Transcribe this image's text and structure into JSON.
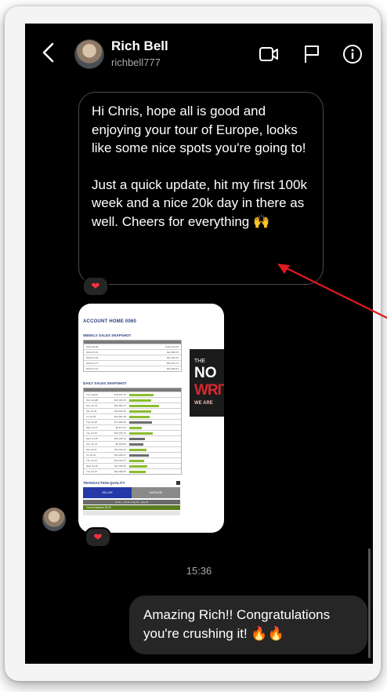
{
  "header": {
    "name": "Rich Bell",
    "handle": "richbell777"
  },
  "messages": {
    "incoming_paragraph_1": "Hi Chris, hope all is good and enjoying your tour of Europe, looks like some nice spots you're going to!",
    "incoming_paragraph_2": "Just a quick update, hit my first 100k week and a nice 20k day in there as well. Cheers for everything 🙌",
    "reaction": "❤",
    "timestamp": "15:36",
    "outgoing": "Amazing Rich!! Congratulations you're crushing it! 🔥🔥"
  },
  "attachment": {
    "title": "ACCOUNT HOME 0060",
    "weekly_heading": "WEEKLY SALES SNAPSHOT",
    "daily_heading": "DAILY SALES SNAPSHOT",
    "quality_heading": "TRANSACTION QUALITY",
    "seller_label": "SELLER",
    "average_label": "AVERAGE",
    "date_range": "Jul 31 - Jul 31 | Aug 01 - Aug 01",
    "current_balance": "Current Balance   $0.00",
    "weekly_rows": [
      {
        "date": "2022-08-08",
        "value": "$116,614.00"
      },
      {
        "date": "2022-07-31",
        "value": "$34,838.78"
      },
      {
        "date": "2022-07-24",
        "value": "$62,400.32"
      },
      {
        "date": "2022-07-17",
        "value": "$69,570.74"
      },
      {
        "date": "2022-07-10",
        "value": "$43,003.42"
      }
    ],
    "daily_rows": [
      {
        "day": "Tue Aug09",
        "value": "$19,872.78",
        "level": 0.62,
        "color": "g"
      },
      {
        "day": "Mon Aug08",
        "value": "$15,432.56",
        "level": 0.55,
        "color": "g"
      },
      {
        "day": "Sun Jul 31",
        "value": "$26,893.37",
        "level": 0.75,
        "color": "g"
      },
      {
        "day": "Sat Jul 30",
        "value": "$16,645.20",
        "level": 0.56,
        "color": "g"
      },
      {
        "day": "Fri Jul 29",
        "value": "$14,651.38",
        "level": 0.52,
        "color": "g"
      },
      {
        "day": "Thu Jul 28",
        "value": "$17,800.40",
        "level": 0.58,
        "color": "k"
      },
      {
        "day": "Wed Jul 27",
        "value": "$9,873.15",
        "level": 0.32,
        "color": "g"
      },
      {
        "day": "Tue Jul 26",
        "value": "$15,076.19",
        "level": 0.6,
        "color": "g"
      },
      {
        "day": "Mon Jul 25",
        "value": "$10,432.10",
        "level": 0.4,
        "color": "k"
      },
      {
        "day": "Sun Jul 24",
        "value": "$9,026.84",
        "level": 0.36,
        "color": "k"
      },
      {
        "day": "Sat Jul 23",
        "value": "$11,010.34",
        "level": 0.44,
        "color": "g"
      },
      {
        "day": "Fri Jul 22",
        "value": "$13,290.47",
        "level": 0.5,
        "color": "k"
      },
      {
        "day": "Thu Jul 21",
        "value": "$10,024.37",
        "level": 0.38,
        "color": "g"
      },
      {
        "day": "Wed Jul 20",
        "value": "$11,780.45",
        "level": 0.46,
        "color": "g"
      },
      {
        "day": "Tue Jul 19",
        "value": "$10,998.81",
        "level": 0.42,
        "color": "g"
      }
    ],
    "promo": {
      "line1": "THE",
      "line2": "NO",
      "line3": "WRIT",
      "line4": "WE ARE"
    }
  },
  "colors": {
    "background": "#000000",
    "outgoing_bubble": "#262626",
    "heart": "#ff3040",
    "annotation_arrow": "#e0191f",
    "green_bar": "#8bbd2f"
  }
}
